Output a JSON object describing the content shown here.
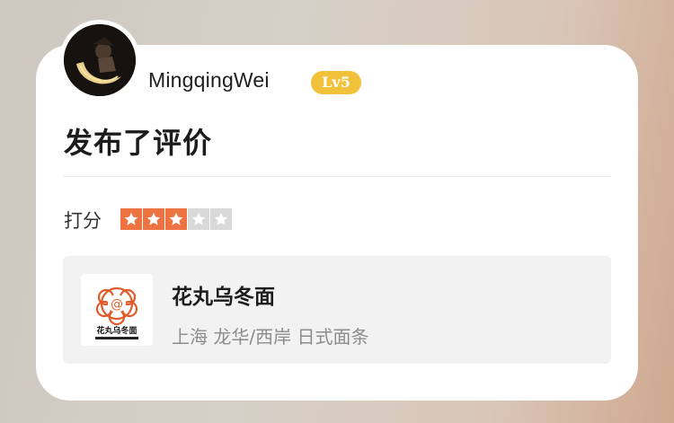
{
  "user": {
    "name": "MingqingWei",
    "level": "Lv5"
  },
  "post": {
    "headline": "发布了评价"
  },
  "rating": {
    "label": "打分",
    "score": 3,
    "max": 5
  },
  "shop": {
    "name": "花丸乌冬面",
    "meta": "上海 龙华/西岸 日式面条",
    "logo_text": "花丸乌冬面"
  },
  "colors": {
    "star_filled": "#ee7342",
    "star_empty": "#d9d9d9",
    "level_badge": "#f2c13a"
  }
}
